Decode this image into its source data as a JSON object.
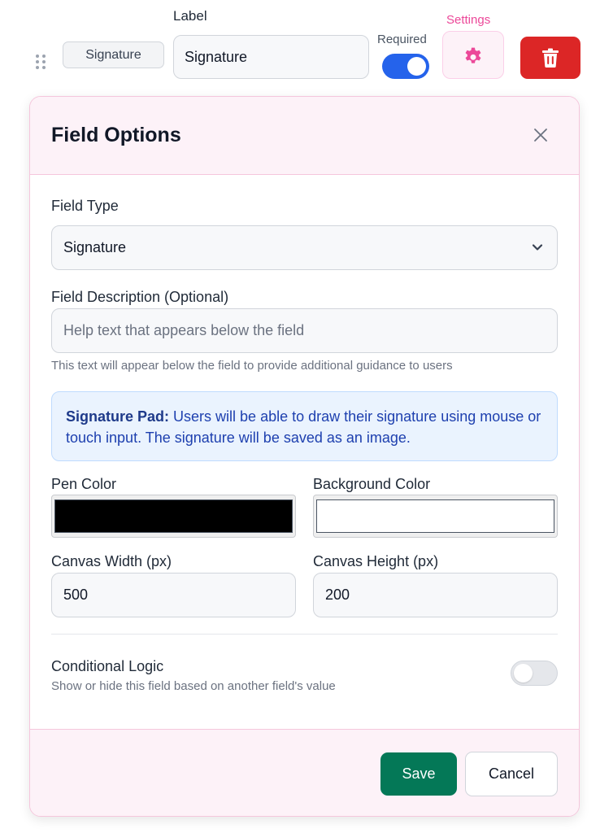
{
  "field_row": {
    "type_badge": "Signature",
    "label_caption": "Label",
    "label_value": "Signature",
    "required_caption": "Required",
    "required_on": true,
    "settings_caption": "Settings",
    "icons": {
      "drag": "drag-handle-icon",
      "settings": "gear-icon",
      "delete": "trash-icon"
    }
  },
  "panel": {
    "title": "Field Options",
    "close_icon": "close-icon",
    "field_type": {
      "label": "Field Type",
      "value": "Signature"
    },
    "description": {
      "label": "Field Description (Optional)",
      "value": "",
      "placeholder": "Help text that appears below the field",
      "help": "This text will appear below the field to provide additional guidance to users"
    },
    "info": {
      "title": "Signature Pad:",
      "body": "Users will be able to draw their signature using mouse or touch input. The signature will be saved as an image."
    },
    "pen_color": {
      "label": "Pen Color",
      "value": "#000000"
    },
    "background_color": {
      "label": "Background Color",
      "value": "#ffffff"
    },
    "canvas_width": {
      "label": "Canvas Width (px)",
      "value": "500"
    },
    "canvas_height": {
      "label": "Canvas Height (px)",
      "value": "200"
    },
    "conditional": {
      "title": "Conditional Logic",
      "description": "Show or hide this field based on another field's value",
      "enabled": false
    },
    "footer": {
      "save_label": "Save",
      "cancel_label": "Cancel"
    }
  },
  "colors": {
    "accent_pink": "#ec4899",
    "primary_blue": "#2563eb",
    "danger_red": "#dc2626",
    "save_green": "#047857"
  }
}
